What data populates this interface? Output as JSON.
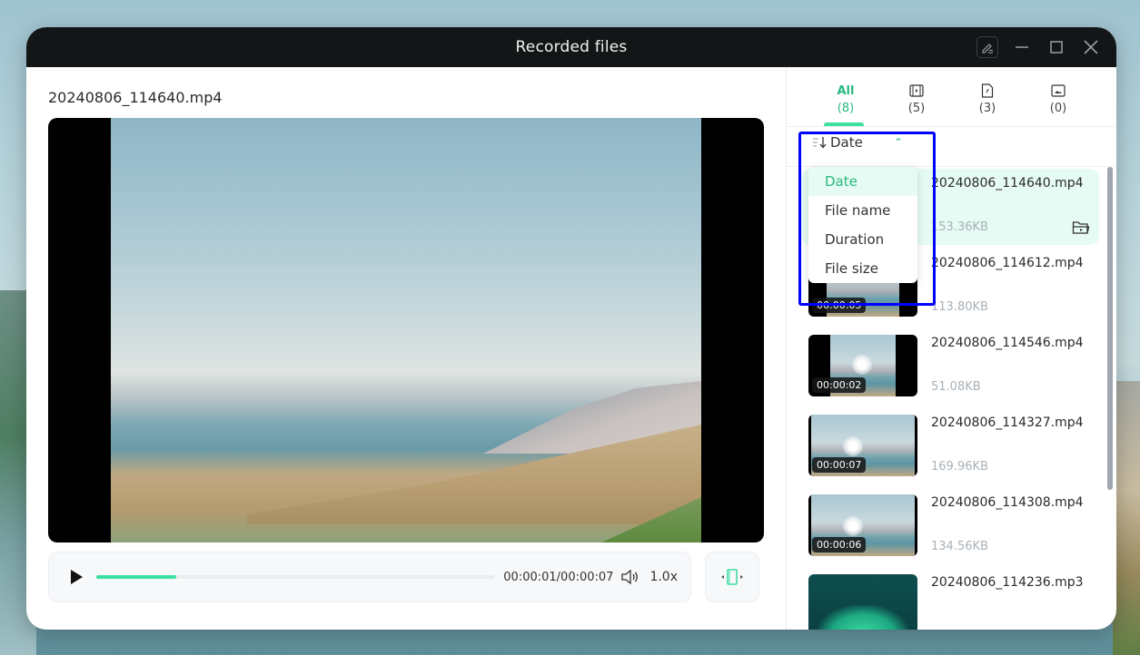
{
  "window": {
    "title": "Recorded files",
    "controls": [
      {
        "name": "edit",
        "icon": "pencil-icon"
      },
      {
        "name": "minimize",
        "icon": "minimize-icon"
      },
      {
        "name": "maximize",
        "icon": "maximize-icon"
      },
      {
        "name": "close",
        "icon": "close-icon"
      }
    ]
  },
  "player": {
    "file_title": "20240806_114640.mp4",
    "progress_fraction": 0.2,
    "time_display": "00:00:01/00:00:07",
    "speed": "1.0x",
    "accent_color": "#3ee0a1"
  },
  "tabs": [
    {
      "label": "All",
      "count": "(8)",
      "active": true
    },
    {
      "icon": "video-icon",
      "count": "(5)"
    },
    {
      "icon": "audio-file-icon",
      "count": "(3)"
    },
    {
      "icon": "image-icon",
      "count": "(0)"
    }
  ],
  "sort": {
    "label": "Date",
    "options": [
      "Date",
      "File name",
      "Duration",
      "File size"
    ],
    "selected": "Date"
  },
  "files": [
    {
      "name": "20240806_114640.mp4",
      "size": "153.36KB",
      "duration": "",
      "selected": true
    },
    {
      "name": "20240806_114612.mp4",
      "size": "113.80KB",
      "duration": "00:00:05"
    },
    {
      "name": "20240806_114546.mp4",
      "size": "51.08KB",
      "duration": "00:00:02"
    },
    {
      "name": "20240806_114327.mp4",
      "size": "169.96KB",
      "duration": "00:00:07"
    },
    {
      "name": "20240806_114308.mp4",
      "size": "134.56KB",
      "duration": "00:00:06"
    },
    {
      "name": "20240806_114236.mp3",
      "size": "",
      "duration": ""
    }
  ]
}
